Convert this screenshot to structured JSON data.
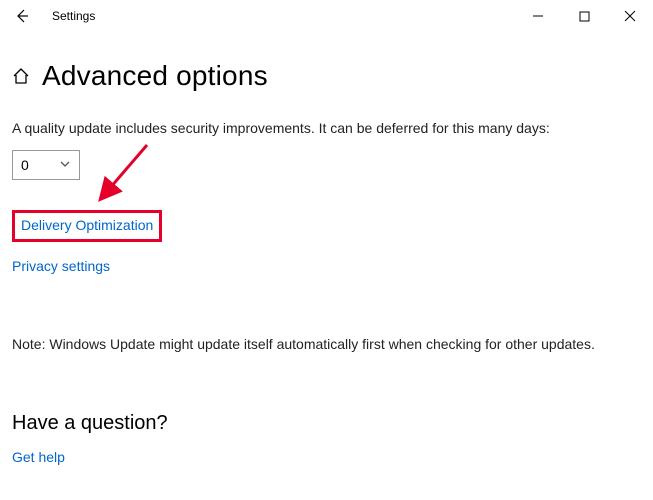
{
  "titlebar": {
    "app_title": "Settings"
  },
  "page": {
    "title": "Advanced options",
    "defer_text": "A quality update includes security improvements. It can be deferred for this many days:",
    "defer_value": "0",
    "link_delivery": "Delivery Optimization",
    "link_privacy": "Privacy settings",
    "note": "Note: Windows Update might update itself automatically first when checking for other updates.",
    "question_heading": "Have a question?",
    "link_help": "Get help"
  }
}
